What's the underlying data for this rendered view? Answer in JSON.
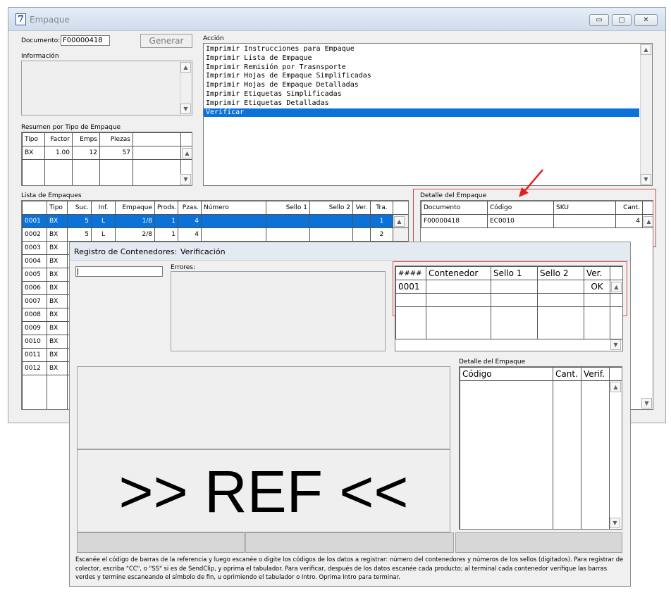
{
  "window": {
    "icon": "7",
    "title": "Empaque",
    "controls": {
      "minimize": "▭",
      "maximize": "▢",
      "close": "✕"
    }
  },
  "documento": {
    "label": "Documento:",
    "value": "F00000418"
  },
  "generar_button": "Generar",
  "informacion_label": "Información",
  "resumen": {
    "label": "Resumen por Tipo de Empaque",
    "headers": [
      "Tipo",
      "Factor",
      "Emps",
      "Piezas"
    ],
    "rows": [
      [
        "BX",
        "1.00",
        "12",
        "57"
      ]
    ]
  },
  "accion": {
    "label": "Acción",
    "items": [
      "Imprimir Instrucciones para Empaque",
      "Imprimir Lista de Empaque",
      "Imprimir Remisión por Trasnsporte",
      "Imprimir Hojas de Empaque Simplificadas",
      "Imprimir Hojas de Empaque Detalladas",
      "Imprimir Etiquetas Simplificadas",
      "Imprimir Etiquetas Detalladas",
      "Verificar"
    ],
    "selected_index": 7
  },
  "lista": {
    "label": "Lista de Empaques",
    "headers": [
      "",
      "Tipo",
      "Suc.",
      "Inf.",
      "Empaque",
      "Prods.",
      "Pzas.",
      "Número",
      "Sello 1",
      "Sello 2",
      "Ver.",
      "Tra."
    ],
    "rows": [
      [
        "0001",
        "BX",
        "5",
        "L",
        "1/8",
        "1",
        "4",
        "",
        "",
        "",
        "",
        "1"
      ],
      [
        "0002",
        "BX",
        "5",
        "L",
        "2/8",
        "1",
        "4",
        "",
        "",
        "",
        "",
        "2"
      ],
      [
        "0003",
        "BX"
      ],
      [
        "0004",
        "BX"
      ],
      [
        "0005",
        "BX"
      ],
      [
        "0006",
        "BX"
      ],
      [
        "0007",
        "BX"
      ],
      [
        "0008",
        "BX"
      ],
      [
        "0009",
        "BX"
      ],
      [
        "0010",
        "BX"
      ],
      [
        "0011",
        "BX"
      ],
      [
        "0012",
        "BX"
      ]
    ]
  },
  "detalle_main": {
    "label": "Detalle del Empaque",
    "headers": [
      "Documento",
      "Código",
      "SKU",
      "Cant."
    ],
    "rows": [
      [
        "F00000418",
        "EC0010",
        "",
        "4"
      ]
    ]
  },
  "dialog": {
    "title": "Registro de Contenedores:",
    "mode": "Verificación",
    "errores_label": "Errores:",
    "contenedores": {
      "headers": [
        "####",
        "Contenedor",
        "Sello 1",
        "Sello 2",
        "Ver."
      ],
      "rows": [
        [
          "0001",
          "",
          "",
          "",
          "OK"
        ]
      ]
    },
    "detalle_label": "Detalle del Empaque",
    "detalle_headers": [
      "Código",
      "Cant.",
      "Verif."
    ],
    "big_text": ">> REF <<",
    "instructions": "Escanée el código de barras de la referencia y luego escanée o digite los códigos de los datos a registrar: número del contenedores y números de los sellos (digitados). Para registrar de colector, escriba \"CC\", o \"SS\" si es de SendClip, y oprima el tabulador. Para verificar, después de los datos escanée cada producto; al terminal cada contenedor verifique las barras verdes y termine escaneando el símbolo de fin, u oprimiendo el tabulador o Intro. Oprima Intro para terminar."
  },
  "colors": {
    "selection": "#0a72d8",
    "annotation": "#e02020"
  }
}
